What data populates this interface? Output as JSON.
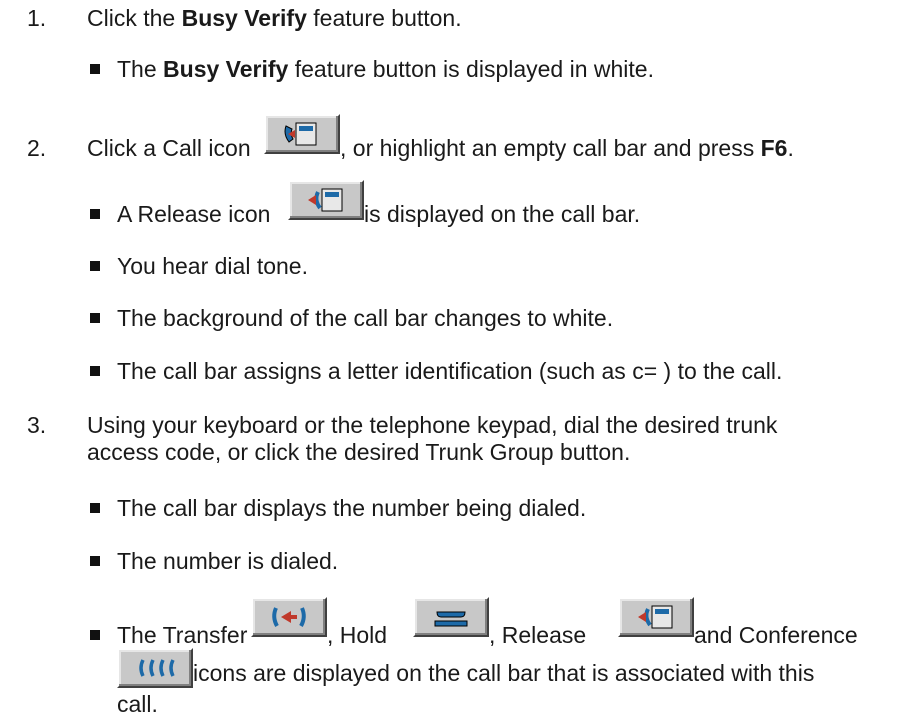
{
  "steps": [
    {
      "num": "1.",
      "pre": "Click the ",
      "bold": "Busy Verify",
      "post": " feature button."
    },
    {
      "num": "2.",
      "pre": "Click a Call icon ",
      "mid": ", or highlight an empty call bar and press ",
      "bold": "F6",
      "post": "."
    },
    {
      "num": "3.",
      "line1": "Using your keyboard or the telephone keypad, dial the desired trunk",
      "line2": "access code, or click the desired Trunk Group button."
    }
  ],
  "bullets": {
    "b1": {
      "pre": "The ",
      "bold": "Busy Verify",
      "post": " feature button is displayed in white."
    },
    "b2": {
      "pre": "A Release icon ",
      "post": " is displayed on the call bar."
    },
    "b3": "You hear dial tone.",
    "b4": "The background of the call bar changes to white.",
    "b5": "The call bar assigns a letter identification (such as c= ) to the call.",
    "b6": "The call bar displays the number being dialed.",
    "b7": "The number is dialed.",
    "b8": {
      "t1": "The Transfer ",
      "t2": ", Hold ",
      "t3": ", Release ",
      "t4": " and Conference",
      "t5": " icons are displayed on the call bar that is associated with this",
      "t6": "call."
    }
  },
  "icons": [
    "call-icon",
    "release-icon",
    "transfer-icon",
    "hold-icon",
    "release-icon",
    "conference-icon"
  ]
}
